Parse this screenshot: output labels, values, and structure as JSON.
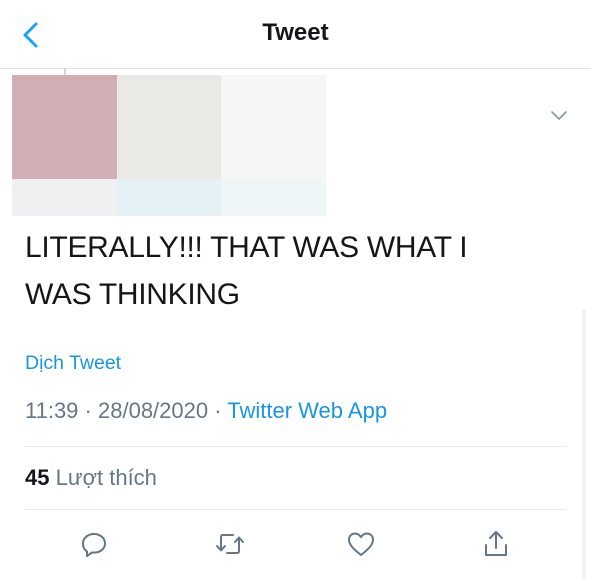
{
  "header": {
    "title": "Tweet",
    "back_icon": "chevron-left-icon"
  },
  "tweet": {
    "text_line1": "LITERALLY!!! THAT WAS WHAT I",
    "text_line2": "WAS THINKING",
    "translate_label": "Dịch Tweet",
    "time": "11:39",
    "date": "28/08/2020",
    "separator": "·",
    "source": "Twitter Web App",
    "like_count": "45",
    "like_label": "Lượt thích"
  },
  "actions": [
    "reply-icon",
    "retweet-icon",
    "like-icon",
    "share-icon"
  ],
  "colors": {
    "accent": "#1b95e0",
    "text": "#14171a",
    "muted": "#657786",
    "divider": "#e1e8ed"
  }
}
